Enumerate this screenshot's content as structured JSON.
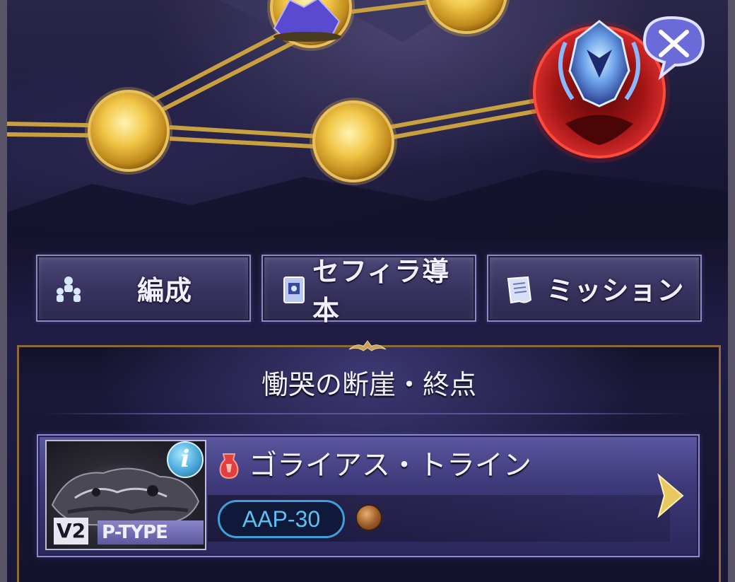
{
  "menu": {
    "formation_label": "編成",
    "sephira_label": "セフィラ導本",
    "mission_label": "ミッション"
  },
  "panel": {
    "title": "慟哭の断崖・終点"
  },
  "quest": {
    "name": "ゴライアス・トライン",
    "version_badge": "V2",
    "type_badge": "P-TYPE",
    "info_label": "i",
    "ap_cost": "AAP-30"
  },
  "icons": {
    "formation": "party-icon",
    "sephira": "book-icon",
    "mission": "scroll-icon",
    "battle": "crossed-swords-icon",
    "info": "info-icon",
    "arrow": "chevron-right-icon",
    "attribute": "fire-element-icon",
    "element_orb": "earth-element-icon"
  },
  "colors": {
    "node_gold": "#f2c84a",
    "path_gold": "#c9a040",
    "boss_red": "#b01818",
    "accent_blue": "#3fa0d8"
  }
}
